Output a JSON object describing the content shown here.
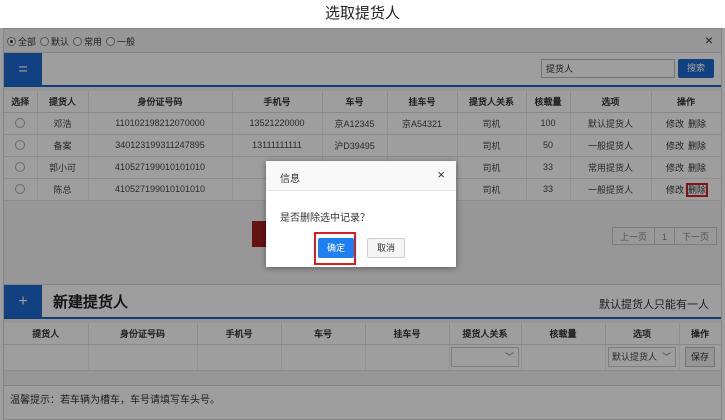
{
  "page_title": "选取提货人",
  "filter": {
    "options": [
      {
        "label": "全部",
        "selected": true
      },
      {
        "label": "默认",
        "selected": false
      },
      {
        "label": "常用",
        "selected": false
      },
      {
        "label": "一般",
        "selected": false
      }
    ],
    "close_icon": "×"
  },
  "list_header": {
    "badge_icon": "=",
    "search_value": "提货人",
    "search_button": "搜索"
  },
  "list_table": {
    "columns": [
      "选择",
      "提货人",
      "身份证号码",
      "手机号",
      "车号",
      "挂车号",
      "提货人关系",
      "核载量",
      "选项",
      "操作"
    ],
    "rows": [
      {
        "name": "邓浩",
        "id": "110102198212070000",
        "phone": "13521220000",
        "plate": "京A12345",
        "trailer": "京A54321",
        "relation": "司机",
        "load": "100",
        "option": "默认提货人"
      },
      {
        "name": "备案",
        "id": "340123199311247895",
        "phone": "13111111111",
        "plate": "沪D39495",
        "trailer": "",
        "relation": "司机",
        "load": "50",
        "option": "一般提货人"
      },
      {
        "name": "郭小可",
        "id": "410527199010101010",
        "phone": "13...",
        "plate": "",
        "trailer": "",
        "relation": "司机",
        "load": "33",
        "option": "常用提货人"
      },
      {
        "name": "陈总",
        "id": "410527199010101010",
        "phone": "13...",
        "plate": "",
        "trailer": "",
        "relation": "司机",
        "load": "33",
        "option": "一般提货人"
      }
    ],
    "action_edit": "修改",
    "action_delete": "删除"
  },
  "pager": {
    "prev": "上一页",
    "current": "1",
    "next": "下一页"
  },
  "new_section": {
    "badge_icon": "+",
    "title": "新建提货人",
    "note": "默认提货人只能有一人",
    "columns": [
      "提货人",
      "身份证号码",
      "手机号",
      "车号",
      "挂车号",
      "提货人关系",
      "核载量",
      "选项",
      "操作"
    ],
    "option_value": "默认提货人",
    "save_button": "保存"
  },
  "tip": "温馨提示：若车辆为槽车，车号请填写车头号。",
  "dialog": {
    "title": "信息",
    "message": "是否删除选中记录？",
    "ok": "确定",
    "cancel": "取消",
    "close_icon": "×"
  },
  "colors": {
    "accent_blue": "#1e6ad2",
    "highlight_red": "#d42020",
    "ok_button": "#1e80f0"
  }
}
